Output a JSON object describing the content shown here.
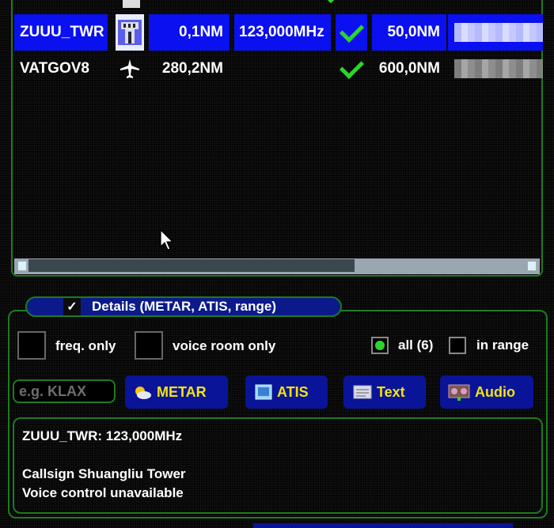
{
  "stations": [
    {
      "callsign": "ZUUU_TWR",
      "icon": "tower-icon",
      "distance": "0,1NM",
      "frequency": "123,000MHz",
      "ok": true,
      "range": "50,0NM",
      "selected": true
    },
    {
      "callsign": "VATGOV8",
      "icon": "airplane-icon",
      "distance": "280,2NM",
      "frequency": "",
      "ok": true,
      "range": "600,0NM",
      "selected": false
    }
  ],
  "details": {
    "header_check": "✓",
    "title": "Details (METAR, ATIS, range)",
    "freq_only_label": "freq. only",
    "voice_room_only_label": "voice room only",
    "all_label": "all (6)",
    "in_range_label": "in range",
    "search_placeholder": "e.g. KLAX",
    "buttons": {
      "metar": "METAR",
      "atis": "ATIS",
      "text": "Text",
      "audio": "Audio"
    },
    "info_lines": [
      "ZUUU_TWR: 123,000MHz",
      "",
      "Callsign  Shuangliu Tower",
      "Voice control unavailable"
    ]
  },
  "colors": {
    "selected_row": "#0a10f0",
    "panel_border": "#1f7a1f",
    "button_bg": "#0a1499",
    "button_text": "#f4e409",
    "check_green": "#2bd62b"
  }
}
